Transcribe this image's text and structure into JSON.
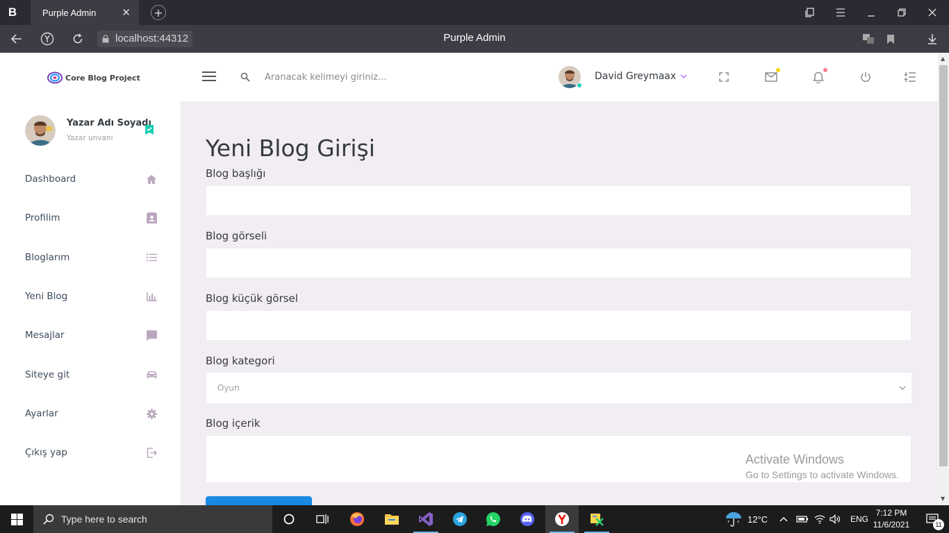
{
  "browser": {
    "logo": "B",
    "tab_title": "Purple Admin",
    "tab_close": "✕",
    "new_tab": "+",
    "url": "localhost:44312",
    "page_title": "Purple Admin"
  },
  "header": {
    "brand": "Core Blog Project",
    "search_placeholder": "Aranacak kelimeyi giriniz...",
    "user_name": "David Greymaax"
  },
  "sidebar": {
    "profile_name": "Yazar Adı Soyadı",
    "profile_title": "Yazar unvanı",
    "items": [
      {
        "label": "Dashboard",
        "icon": "home-icon"
      },
      {
        "label": "Profilim",
        "icon": "contact-card-icon"
      },
      {
        "label": "Bloglarım",
        "icon": "list-icon"
      },
      {
        "label": "Yeni Blog",
        "icon": "bar-chart-icon"
      },
      {
        "label": "Mesajlar",
        "icon": "message-icon"
      },
      {
        "label": "Siteye git",
        "icon": "car-icon"
      },
      {
        "label": "Ayarlar",
        "icon": "gear-icon"
      },
      {
        "label": "Çıkış yap",
        "icon": "exit-icon"
      }
    ]
  },
  "form": {
    "heading": "Yeni Blog Girişi",
    "title_label": "Blog başlığı",
    "image_label": "Blog görseli",
    "thumb_label": "Blog küçük görsel",
    "category_label": "Blog kategori",
    "category_selected": "Oyun",
    "content_label": "Blog içerik"
  },
  "watermark": {
    "line1": "Activate Windows",
    "line2": "Go to Settings to activate Windows."
  },
  "taskbar": {
    "search_placeholder": "Type here to search",
    "weather": "12°C",
    "language": "ENG",
    "time": "7:12 PM",
    "date": "11/6/2021",
    "notification_count": "11"
  },
  "colors": {
    "accent_purple": "#b66dff",
    "primary_blue": "#198ae3",
    "success_teal": "#1bcfb4",
    "page_bg": "#f2edf3"
  }
}
